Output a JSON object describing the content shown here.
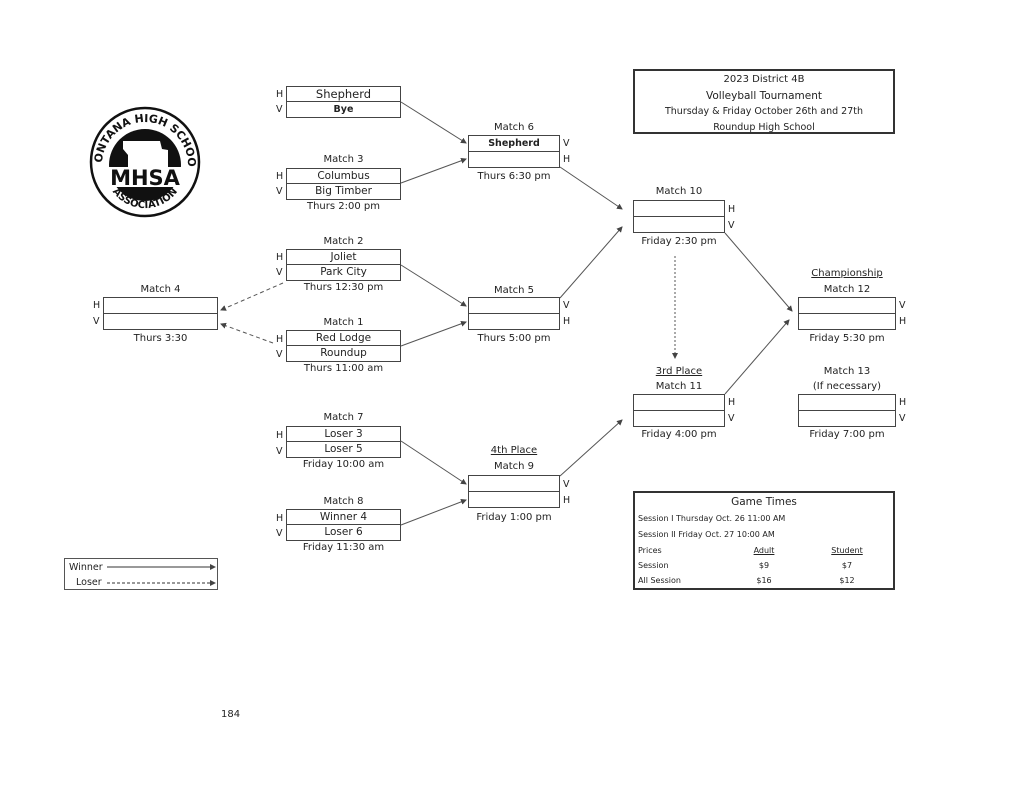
{
  "title_box": {
    "line1": "2023 District 4B",
    "line2": "Volleyball Tournament",
    "line3": "Thursday & Friday October 26th and 27th",
    "line4": "Roundup High School"
  },
  "logo": {
    "top_text": "MONTANA HIGH SCHOOL",
    "center_text": "MHSA",
    "bottom_text": "ASSOCIATION"
  },
  "home_label": "H",
  "visitor_label": "V",
  "matches": {
    "bye": {
      "title": "",
      "top": "Shepherd",
      "bottom": "Bye",
      "time": ""
    },
    "m3": {
      "title": "Match 3",
      "top": "Columbus",
      "bottom": "Big Timber",
      "time": "Thurs 2:00 pm"
    },
    "m2": {
      "title": "Match 2",
      "top": "Joliet",
      "bottom": "Park City",
      "time": "Thurs 12:30 pm"
    },
    "m1": {
      "title": "Match 1",
      "top": "Red Lodge",
      "bottom": "Roundup",
      "time": "Thurs 11:00 am"
    },
    "m7": {
      "title": "Match 7",
      "top": "Loser 3",
      "bottom": "Loser 5",
      "time": "Friday 10:00 am"
    },
    "m8": {
      "title": "Match 8",
      "top": "Winner 4",
      "bottom": "Loser 6",
      "time": "Friday 11:30 am"
    },
    "m4": {
      "title": "Match 4",
      "top": "",
      "bottom": "",
      "time": "Thurs 3:30"
    },
    "m6": {
      "title": "Match 6",
      "top": "Shepherd",
      "bottom": "",
      "time": "Thurs 6:30 pm"
    },
    "m5": {
      "title": "Match 5",
      "top": "",
      "bottom": "",
      "time": "Thurs 5:00 pm"
    },
    "m9": {
      "heading": "4th Place",
      "title": "Match 9",
      "top": "",
      "bottom": "",
      "time": "Friday 1:00 pm"
    },
    "m10": {
      "title": "Match 10",
      "top": "",
      "bottom": "",
      "time": "Friday 2:30 pm"
    },
    "m11": {
      "heading": "3rd Place",
      "title": "Match 11",
      "top": "",
      "bottom": "",
      "time": "Friday 4:00 pm"
    },
    "m12": {
      "heading": "Championship",
      "title": "Match 12",
      "top": "",
      "bottom": "",
      "time": "Friday 5:30 pm"
    },
    "m13": {
      "title": "Match 13",
      "subtitle": "(If necessary)",
      "top": "",
      "bottom": "",
      "time": "Friday 7:00 pm"
    }
  },
  "game_times": {
    "title": "Game Times",
    "session1": "Session I Thursday Oct. 26 11:00 AM",
    "session2": "Session II Friday Oct. 27 10:00 AM",
    "prices_label": "Prices",
    "adult_label": "Adult",
    "student_label": "Student",
    "rows": [
      {
        "label": "Session",
        "adult": "$9",
        "student": "$7"
      },
      {
        "label": "All Session",
        "adult": "$16",
        "student": "$12"
      }
    ]
  },
  "legend": {
    "winner": "Winner",
    "loser": "Loser"
  },
  "page_number": "184"
}
